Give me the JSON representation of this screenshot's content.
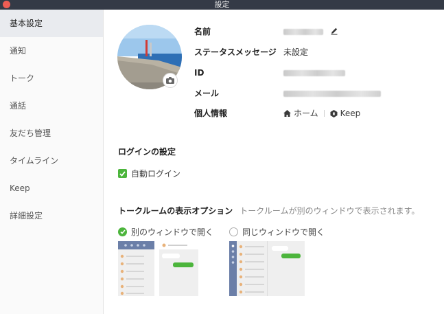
{
  "window": {
    "title": "設定"
  },
  "sidebar": {
    "items": [
      {
        "label": "基本設定",
        "active": true
      },
      {
        "label": "通知"
      },
      {
        "label": "トーク"
      },
      {
        "label": "通話"
      },
      {
        "label": "友だち管理"
      },
      {
        "label": "タイムライン"
      },
      {
        "label": "Keep"
      },
      {
        "label": "詳細設定"
      }
    ]
  },
  "profile": {
    "name_label": "名前",
    "status_label": "ステータスメッセージ",
    "status_value": "未設定",
    "id_label": "ID",
    "email_label": "メール",
    "personal_label": "個人情報",
    "home_link": "ホーム",
    "keep_link": "Keep"
  },
  "login": {
    "title": "ログインの設定",
    "auto_login_label": "自動ログイン",
    "auto_login_checked": true
  },
  "talkroom": {
    "title": "トークルームの表示オプション",
    "hint": "トークルームが別のウィンドウで表示されます。",
    "option_separate_label": "別のウィンドウで開く",
    "option_same_label": "同じウィンドウで開く",
    "selected": "separate"
  },
  "colors": {
    "accent_green": "#4cb53c",
    "titlebar": "#343a46",
    "sidebar_active": "#e9ebef",
    "preview_blue": "#6b7fa8"
  },
  "icons": [
    "close-icon",
    "camera-icon",
    "edit-icon",
    "home-icon",
    "keep-icon",
    "check-icon"
  ]
}
